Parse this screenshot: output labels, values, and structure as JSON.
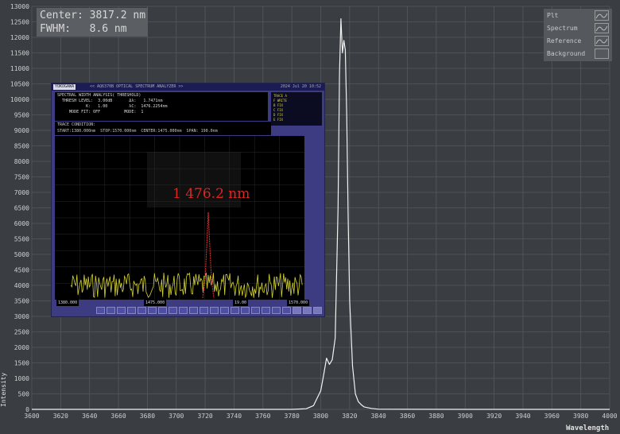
{
  "readout": {
    "center_label": "Center:",
    "center_value": "3817.2 nm",
    "fwhm_label": "FWHM:",
    "fwhm_value": "8.6 nm"
  },
  "legend": {
    "items": [
      "Plt",
      "Spectrum",
      "Reference",
      "Background"
    ]
  },
  "axes": {
    "x_label": "Wavelength",
    "y_label": "Intensity",
    "x_ticks": [
      "3600",
      "3620",
      "3640",
      "3660",
      "3680",
      "3700",
      "3720",
      "3740",
      "3760",
      "3780",
      "3800",
      "3820",
      "3840",
      "3860",
      "3880",
      "3900",
      "3920",
      "3940",
      "3960",
      "3980",
      "4000"
    ],
    "y_ticks": [
      "0",
      "500",
      "1000",
      "1500",
      "2000",
      "2500",
      "3000",
      "3500",
      "4000",
      "4500",
      "5000",
      "5500",
      "6000",
      "6500",
      "7000",
      "7500",
      "8000",
      "8500",
      "9000",
      "9500",
      "10000",
      "10500",
      "11000",
      "11500",
      "12000",
      "12500",
      "13000"
    ]
  },
  "colors": {
    "background": "#3a3d42",
    "grid": "#55595f",
    "trace": "#f2f2f2",
    "osa_frame": "#3d3c82",
    "osa_trace": "#d4d430",
    "osa_peak": "#e03030",
    "annotation": "#e02424"
  },
  "chart_data": {
    "type": "line",
    "xlabel": "Wavelength",
    "ylabel": "Intensity",
    "xlim": [
      3600,
      4000
    ],
    "ylim": [
      0,
      13000
    ],
    "grid": true,
    "legend_position": "top-right",
    "series": [
      {
        "x": [
          3600,
          3700,
          3780,
          3790,
          3795,
          3800,
          3802,
          3804,
          3806,
          3808,
          3810,
          3812,
          3813,
          3814,
          3815,
          3816,
          3817,
          3818,
          3819,
          3820,
          3822,
          3824,
          3826,
          3828,
          3830,
          3835,
          3840,
          3900,
          4000
        ],
        "y": [
          0,
          0,
          0,
          20,
          120,
          600,
          1100,
          1650,
          1450,
          1600,
          2300,
          6500,
          10800,
          12600,
          11500,
          11900,
          11600,
          9500,
          6200,
          3500,
          1400,
          500,
          250,
          150,
          80,
          30,
          5,
          0,
          0
        ]
      }
    ]
  },
  "osa": {
    "brand": "YOKOGAWA",
    "title": "<< AQ6370B OPTICAL SPECTRUM ANALYZER >>",
    "datetime": "2024 Jul 20 10:52",
    "analysis": {
      "line1": "SPECTRAL WIDTH ANALYSIS( THRESHOLD)",
      "line2": "  THRESH LEVEL:  3.00dB       Δλ:   1.7471nm",
      "line3": "            K:   1.00         λC:  1476.2254nm",
      "line4": "     MODE FIT: OFF          MODE:  1"
    },
    "side_rows": [
      "TRACE A",
      "F WRITE",
      "B FIX",
      "C FIX",
      "D FIX",
      "E FIX"
    ],
    "trace_cond": {
      "line1": "TRACE CONDITION:",
      "line2": "START:1380.000nm  STOP:1570.000nm  CENTER:1475.000nm  SPAN: 190.0nm"
    },
    "annotation": "1 476.2 nm",
    "foot": {
      "start": "1380.000",
      "center": "1475.000",
      "span": "19.00",
      "stop": "1570.000"
    }
  }
}
